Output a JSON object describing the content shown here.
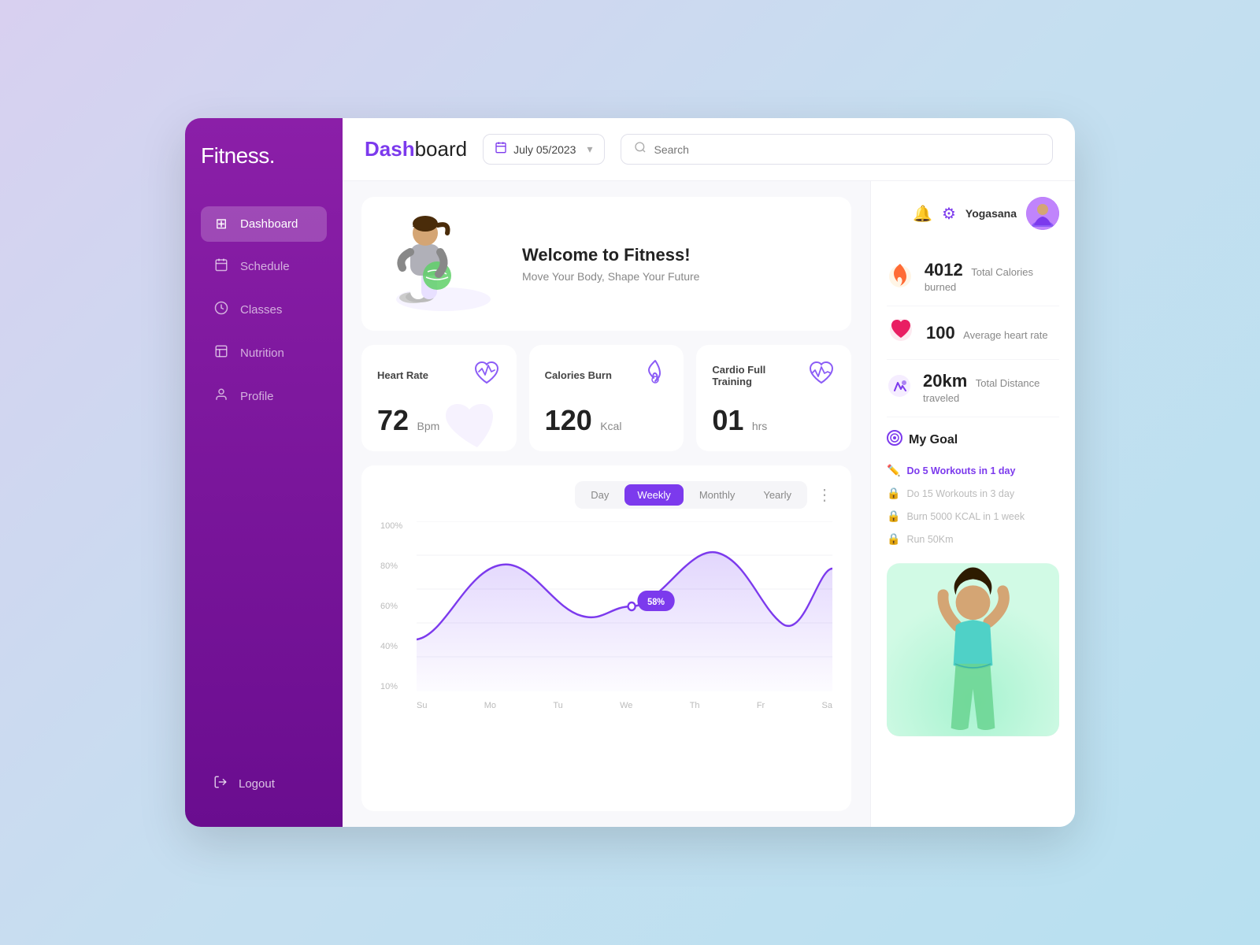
{
  "app": {
    "logo_bold": "Fit",
    "logo_light": "ness.",
    "logo_dot": "."
  },
  "sidebar": {
    "items": [
      {
        "id": "dashboard",
        "label": "Dashboard",
        "icon": "⊞",
        "active": true
      },
      {
        "id": "schedule",
        "label": "Schedule",
        "icon": "📅",
        "active": false
      },
      {
        "id": "classes",
        "label": "Classes",
        "icon": "🕐",
        "active": false
      },
      {
        "id": "nutrition",
        "label": "Nutrition",
        "icon": "📋",
        "active": false
      },
      {
        "id": "profile",
        "label": "Profile",
        "icon": "👤",
        "active": false
      }
    ],
    "logout_label": "Logout"
  },
  "header": {
    "title_bold": "Dash",
    "title_light": "board",
    "date": "July 05/2023",
    "search_placeholder": "Search"
  },
  "user": {
    "name": "Yogasana",
    "bell_icon": "🔔",
    "gear_icon": "⚙"
  },
  "stats_right": [
    {
      "id": "calories",
      "icon": "🔥",
      "icon_color": "#ff6b35",
      "value": "4012",
      "label": "Total Calories burned"
    },
    {
      "id": "heart",
      "icon": "❤️",
      "icon_color": "#e91e8c",
      "value": "100",
      "label": "Average heart rate"
    },
    {
      "id": "distance",
      "icon": "🏃",
      "icon_color": "#7c3aed",
      "value": "20km",
      "label": "Total Distance traveled"
    }
  ],
  "goals": {
    "title": "My Goal",
    "items": [
      {
        "id": "goal1",
        "label": "Do 5 Workouts in 1 day",
        "active": true,
        "icon": "✏️"
      },
      {
        "id": "goal2",
        "label": "Do 15 Workouts in 3 day",
        "active": false,
        "icon": "🔒"
      },
      {
        "id": "goal3",
        "label": "Burn 5000 KCAL in 1 week",
        "active": false,
        "icon": "🔒"
      },
      {
        "id": "goal4",
        "label": "Run 50Km",
        "active": false,
        "icon": "🔒"
      }
    ]
  },
  "welcome": {
    "title": "Welcome to Fitness!",
    "subtitle": "Move Your Body, Shape Your Future"
  },
  "stat_cards": [
    {
      "id": "heart-rate",
      "title": "Heart Rate",
      "value": "72",
      "unit": "Bpm",
      "icon": "💗"
    },
    {
      "id": "calories-burn",
      "title": "Calories Burn",
      "value": "120",
      "unit": "Kcal",
      "icon": "🔥"
    },
    {
      "id": "cardio",
      "title": "Cardio Full Training",
      "value": "01",
      "unit": "hrs",
      "icon": "💓"
    }
  ],
  "chart": {
    "tabs": [
      "Day",
      "Weekly",
      "Monthly",
      "Yearly"
    ],
    "active_tab": "Weekly",
    "active_tab_index": 1,
    "tooltip_value": "58%",
    "y_labels": [
      "100%",
      "80%",
      "60%",
      "40%",
      "10%"
    ],
    "x_labels": [
      "Su",
      "Mo",
      "Tu",
      "We",
      "Th",
      "Fr",
      "Sa"
    ],
    "more_icon": "⋮"
  }
}
